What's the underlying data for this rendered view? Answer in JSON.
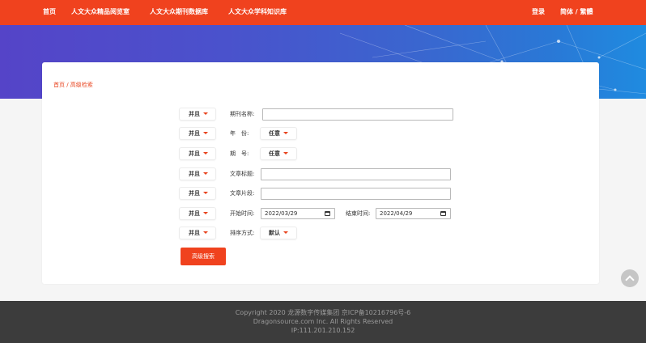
{
  "nav": {
    "items": [
      "首页",
      "人文大众精品阅览室",
      "人文大众期刊数据库",
      "人文大众学科知识库"
    ],
    "login": "登录",
    "lang": "简体 / 繁體"
  },
  "breadcrumb": "首页 / 高级检索",
  "form": {
    "rows": [
      {
        "logic": "并且",
        "label": "期刊名称:"
      },
      {
        "logic": "并且",
        "label": "年　份:",
        "select": "任意"
      },
      {
        "logic": "并且",
        "label": "期　号:",
        "select": "任意"
      },
      {
        "logic": "并且",
        "label": "文章标题:"
      },
      {
        "logic": "并且",
        "label": "文章片段:"
      },
      {
        "logic": "并且",
        "label": "开始时间:",
        "date": "2022/03/29",
        "end_label": "结束时间:",
        "end_date": "2022/04/29"
      },
      {
        "logic": "并且",
        "label": "排序方式:",
        "select": "默认"
      }
    ],
    "search_label": "高级搜索"
  },
  "footer": {
    "line1": "Copyright 2020 龙源数字传媒集团 京ICP备10216796号-6",
    "line2": "Dragonsource.com Inc. All Rights Reserved",
    "line3": "IP:111.201.210.152"
  },
  "colors": {
    "brand": "#f0421e",
    "footer_bg": "#3c3c3c"
  }
}
